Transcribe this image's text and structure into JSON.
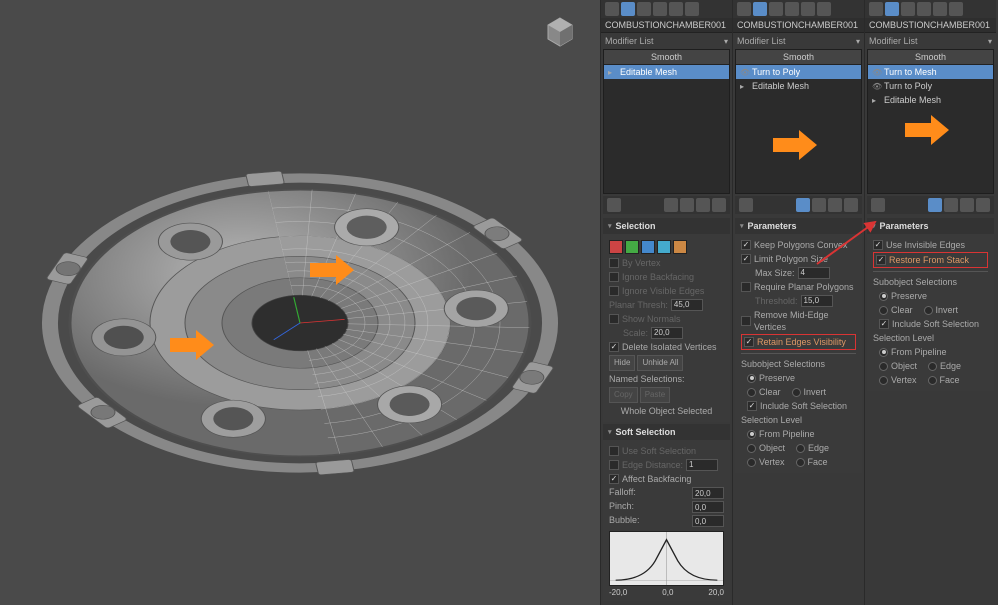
{
  "object_name": "COMBUSTIONCHAMBER001",
  "modifier_list_label": "Modifier List",
  "stack": {
    "smooth": "Smooth",
    "turn_to_poly": "Turn to Poly",
    "turn_to_mesh": "Turn to Mesh",
    "editable_mesh": "Editable Mesh"
  },
  "panel1": {
    "rollouts": {
      "selection": {
        "title": "Selection",
        "by_vertex": "By Vertex",
        "ignore_backfacing": "Ignore Backfacing",
        "ignore_visible_edges": "Ignore Visible Edges",
        "planar_thresh": "Planar Thresh:",
        "planar_thresh_val": "45,0",
        "show_normals": "Show Normals",
        "scale": "Scale:",
        "scale_val": "20,0",
        "delete_isolated": "Delete Isolated Vertices",
        "hide": "Hide",
        "unhide_all": "Unhide All",
        "named_selections": "Named Selections:",
        "copy": "Copy",
        "paste": "Paste",
        "whole_object": "Whole Object Selected"
      },
      "soft_selection": {
        "title": "Soft Selection",
        "use_soft": "Use Soft Selection",
        "edge_distance": "Edge Distance:",
        "edge_distance_val": "1",
        "affect_backfacing": "Affect Backfacing",
        "falloff": "Falloff:",
        "falloff_val": "20,0",
        "pinch": "Pinch:",
        "pinch_val": "0,0",
        "bubble": "Bubble:",
        "bubble_val": "0,0",
        "graph_min": "-20,0",
        "graph_mid": "0,0",
        "graph_max": "20,0"
      }
    }
  },
  "panel2": {
    "rollouts": {
      "parameters": {
        "title": "Parameters",
        "keep_convex": "Keep Polygons Convex",
        "limit_poly_size": "Limit Polygon Size",
        "max_size": "Max Size:",
        "max_size_val": "4",
        "require_planar": "Require Planar Polygons",
        "threshold": "Threshold:",
        "threshold_val": "15,0",
        "remove_mid_edge": "Remove Mid-Edge Vertices",
        "retain_edges": "Retain Edges Visibility",
        "subobj_title": "Subobject Selections",
        "preserve": "Preserve",
        "clear": "Clear",
        "invert": "Invert",
        "include_soft": "Include Soft Selection",
        "sel_level_title": "Selection Level",
        "from_pipeline": "From Pipeline",
        "object": "Object",
        "edge": "Edge",
        "vertex": "Vertex",
        "face": "Face"
      }
    }
  },
  "panel3": {
    "rollouts": {
      "parameters": {
        "title": "Parameters",
        "use_invisible": "Use Invisible Edges",
        "restore_from_stack": "Restore From Stack",
        "subobj_title": "Subobject Selections",
        "preserve": "Preserve",
        "clear": "Clear",
        "invert": "Invert",
        "include_soft": "Include Soft Selection",
        "sel_level_title": "Selection Level",
        "from_pipeline": "From Pipeline",
        "object": "Object",
        "edge": "Edge",
        "vertex": "Vertex",
        "face": "Face"
      }
    }
  }
}
